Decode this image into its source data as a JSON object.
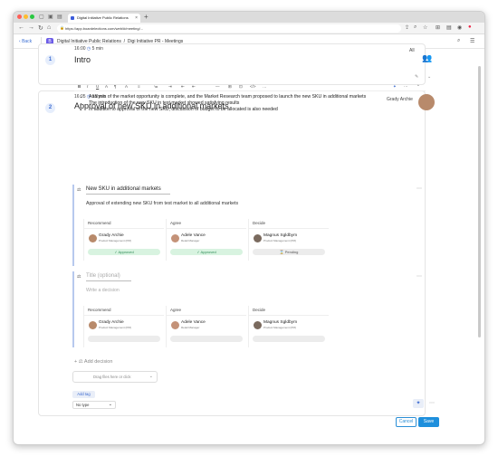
{
  "browser": {
    "tab_title": "Digital Initiative Public Relations",
    "url": "https://app.boardelections.com/web/#/meeting/...",
    "colors": {
      "close": "#ff5f57",
      "min": "#febc2e",
      "max": "#28c840"
    }
  },
  "app_header": {
    "back_label": "Back",
    "logo_letter": "B",
    "org": "Digital Initiative Public Relations",
    "separator": "/",
    "meeting": "Digi Initiative PR - Meetings"
  },
  "item1": {
    "number": "1",
    "time": "16:00",
    "duration": "5 min",
    "title": "Intro",
    "assignee": "All"
  },
  "item2": {
    "number": "2",
    "time": "16:05",
    "duration": "15 min",
    "title": "Approval of new SKU in additional markets",
    "presenter": "Grady Archie",
    "bullets": [
      "Analysis of the market opportunity is complete, and the Market Research team proposed to launch the new SKU in additional markets",
      "The introduction of the new SKU in test market showed satisfying results",
      "In addition to approval of the new SKU, discussion of budget to be allocated is also needed"
    ]
  },
  "toolbar": {
    "items": [
      "B",
      "I",
      "U",
      "A",
      "¶",
      "A",
      "≡",
      "≔",
      "⇥",
      "⇤",
      "⇤",
      "—",
      "⊞",
      "⊡",
      "</>",
      "…"
    ]
  },
  "decision1": {
    "title": "New SKU in additional markets",
    "description": "Approval of extending new SKU from test market to all additional markets",
    "columns": [
      {
        "header": "Recommend",
        "name": "Grady Archie",
        "role": "Product Management (PM)",
        "status": "✓ Approved"
      },
      {
        "header": "Agree",
        "name": "Adele Vance",
        "role": "Retail Manager",
        "status": "✓ Approved"
      },
      {
        "header": "Decide",
        "name": "Magnus Sgldbym",
        "role": "Product Management (PM)",
        "status": "⌛ Pending"
      }
    ]
  },
  "decision2": {
    "title_placeholder": "Title (optional)",
    "description_placeholder": "Write a decision",
    "columns": [
      {
        "header": "Recommend",
        "name": "Grady Archie",
        "role": "Product Management (PM)"
      },
      {
        "header": "Agree",
        "name": "Adele Vance",
        "role": "Retail Manager"
      },
      {
        "header": "Decide",
        "name": "Magnus Sgldbym",
        "role": "Product Management (PM)"
      }
    ]
  },
  "add_decision_label": "Add decision",
  "dropzone_label": "Drag files here or click",
  "add_tag_label": "Add tag",
  "type_select_value": "No type",
  "cancel_label": "Cancel",
  "save_label": "Save"
}
